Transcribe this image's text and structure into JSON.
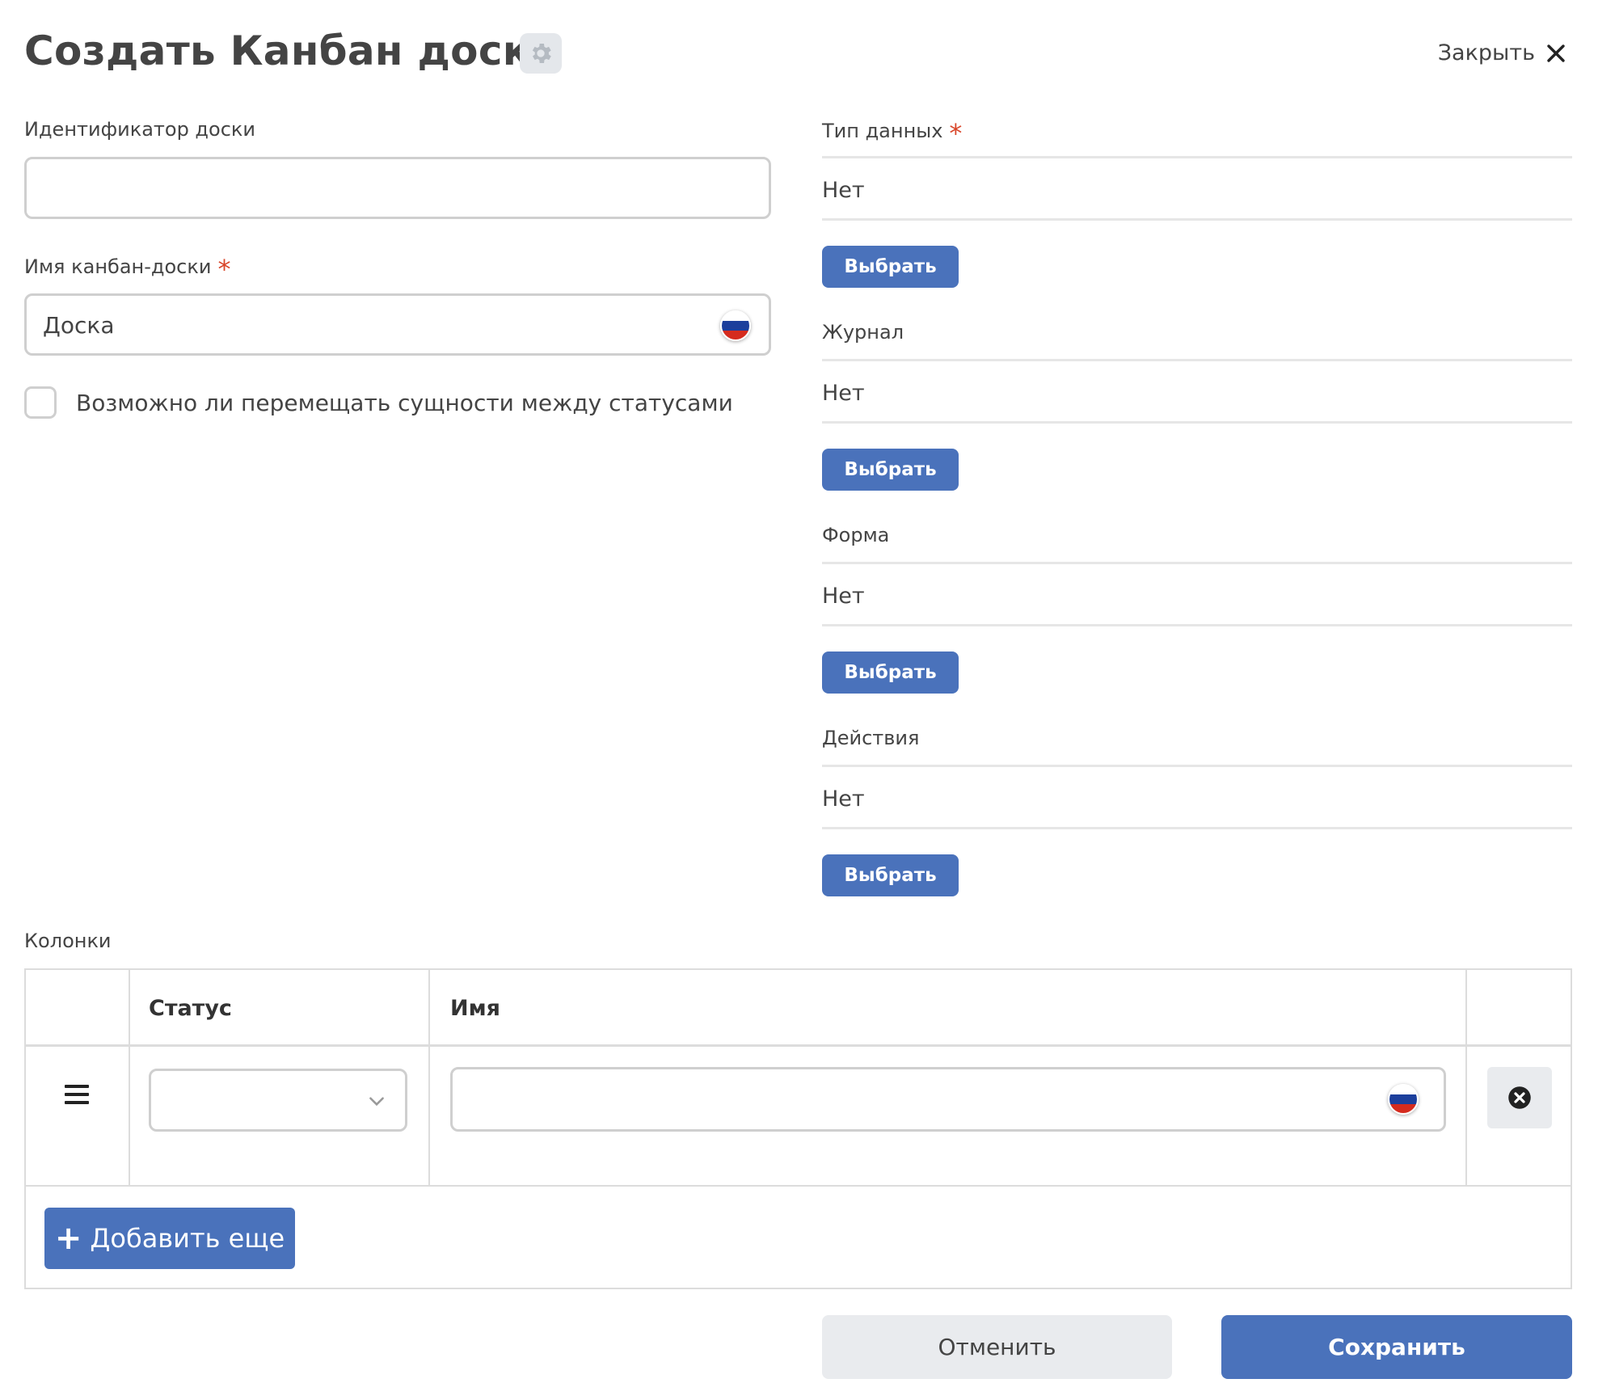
{
  "header": {
    "title": "Создать Канбан доска",
    "settings_icon": "gear-icon",
    "close_label": "Закрыть",
    "close_icon": "close-icon"
  },
  "form": {
    "board_id": {
      "label": "Идентификатор доски",
      "value": ""
    },
    "board_name": {
      "label": "Имя канбан-доски",
      "required_mark": "*",
      "value": "Доска",
      "locale_icon": "ru-flag-icon"
    },
    "move_between_statuses": {
      "label": "Возможно ли перемещать сущности между статусами",
      "checked": false
    }
  },
  "right": {
    "data_type": {
      "label": "Тип данных",
      "required_mark": "*",
      "value": "Нет",
      "button": "Выбрать"
    },
    "journal": {
      "label": "Журнал",
      "value": "Нет",
      "button": "Выбрать"
    },
    "form": {
      "label": "Форма",
      "value": "Нет",
      "button": "Выбрать"
    },
    "actions": {
      "label": "Действия",
      "value": "Нет",
      "button": "Выбрать"
    }
  },
  "columns": {
    "label": "Колонки",
    "headers": {
      "status": "Статус",
      "name": "Имя"
    },
    "rows": [
      {
        "status": "",
        "name": ""
      }
    ],
    "add_button": {
      "icon": "+",
      "label": "Добавить еще"
    }
  },
  "footer": {
    "cancel": "Отменить",
    "save": "Сохранить"
  },
  "colors": {
    "accent": "#4a72bb",
    "required": "#d9472b",
    "text": "#444444",
    "border": "#cfcfcf"
  }
}
